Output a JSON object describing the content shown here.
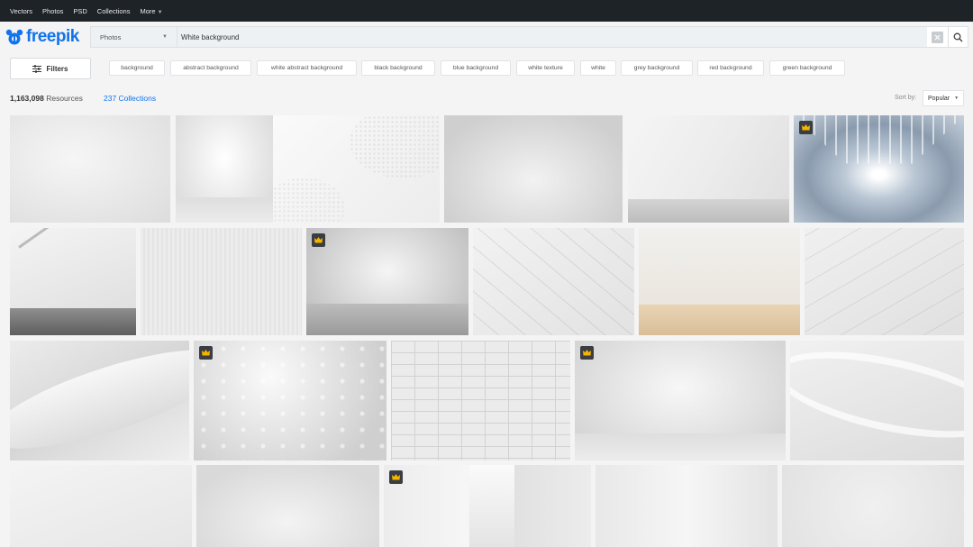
{
  "topnav": {
    "links": [
      "Vectors",
      "Photos",
      "PSD",
      "Collections",
      "More"
    ]
  },
  "brand": {
    "logo_text": "freepik"
  },
  "search": {
    "type_label": "Photos",
    "query": "White background"
  },
  "filters": {
    "label": "Filters"
  },
  "tags": [
    "background",
    "abstract background",
    "white abstract background",
    "black background",
    "blue background",
    "white texture",
    "white",
    "grey background",
    "red background",
    "green background"
  ],
  "results": {
    "count": "1,163,098",
    "count_suffix": "Resources",
    "collections": "237 Collections"
  },
  "sort": {
    "label": "Sort by:",
    "value": "Popular"
  },
  "colors": {
    "brand": "#1273eb",
    "topnav_bg": "#1e2328",
    "premium_badge": "#3a3d42",
    "crown": "#f5b400"
  },
  "gallery": {
    "premium_flags": [
      false,
      false,
      false,
      false,
      false,
      true,
      false,
      false,
      true,
      false,
      false,
      false,
      false,
      true,
      false,
      true,
      false,
      false,
      false,
      true,
      false,
      false
    ]
  }
}
